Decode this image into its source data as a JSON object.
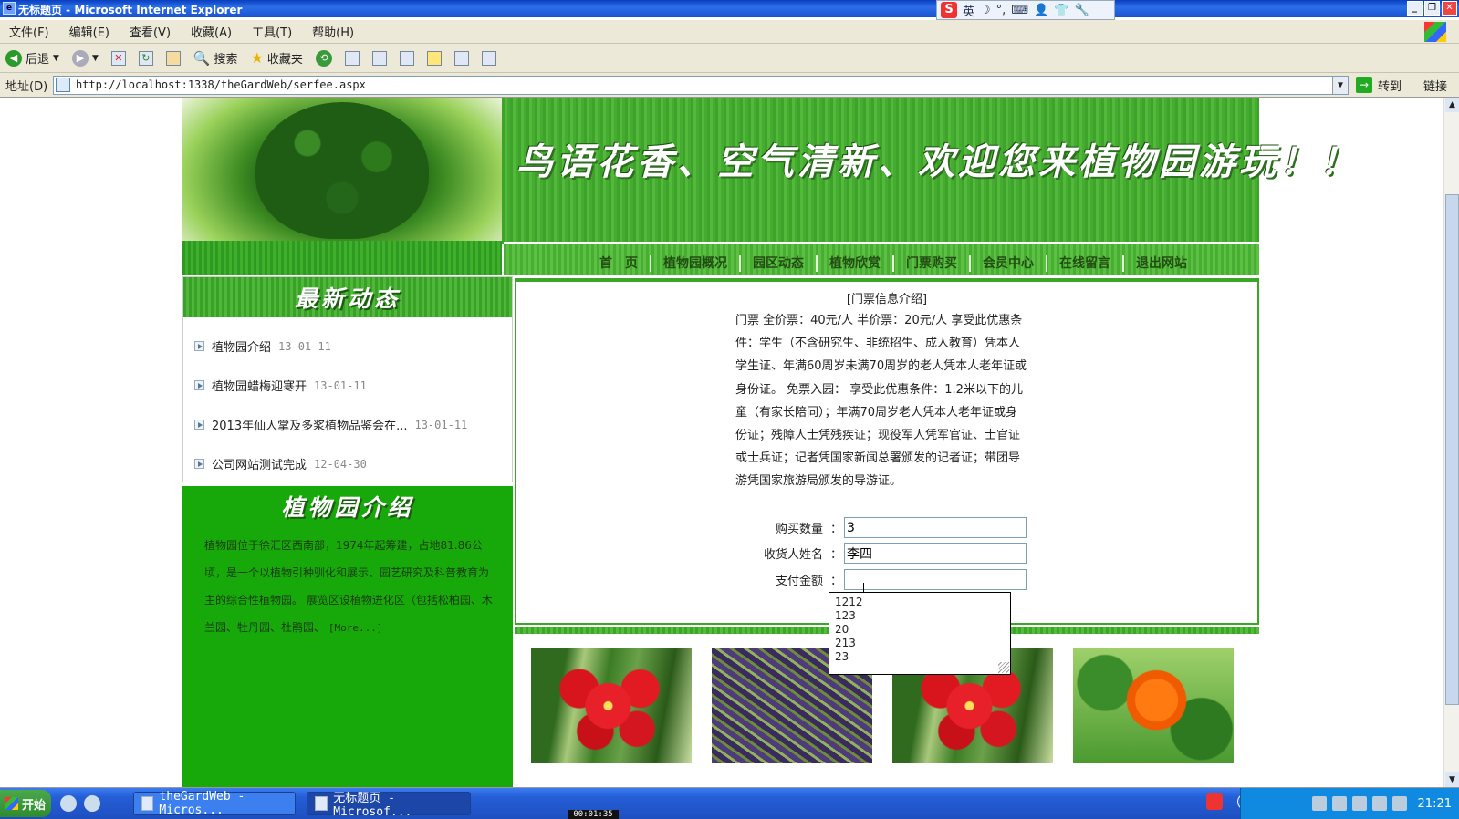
{
  "window": {
    "title": "无标题页 - Microsoft Internet Explorer",
    "controls": [
      "_",
      "❐",
      "✕"
    ]
  },
  "ime": {
    "items": [
      "S",
      "英",
      "☽",
      "°,",
      "⌨",
      "👤",
      "👕",
      "🔧"
    ]
  },
  "menu": [
    "文件(F)",
    "编辑(E)",
    "查看(V)",
    "收藏(A)",
    "工具(T)",
    "帮助(H)"
  ],
  "toolbar": {
    "back": "后退",
    "search": "搜索",
    "favorites": "收藏夹"
  },
  "address": {
    "label": "地址(D)",
    "url": "http://localhost:1338/theGardWeb/serfee.aspx",
    "go": "转到",
    "links": "链接"
  },
  "site": {
    "banner_title": "鸟语花香、空气清新、欢迎您来植物园游玩！！",
    "nav": [
      "首　页",
      "植物园概况",
      "园区动态",
      "植物欣赏",
      "门票购买",
      "会员中心",
      "在线留言",
      "退出网站"
    ],
    "news": {
      "heading": "最新动态",
      "items": [
        {
          "title": "植物园介绍",
          "date": "13-01-11"
        },
        {
          "title": "植物园蜡梅迎寒开",
          "date": "13-01-11"
        },
        {
          "title": "2013年仙人掌及多浆植物品鉴会在...",
          "date": "13-01-11"
        },
        {
          "title": "公司网站测试完成",
          "date": "12-04-30"
        }
      ]
    },
    "intro": {
      "heading": "植物园介绍",
      "text": "植物园位于徐汇区西南部，1974年起筹建，占地81.86公顷，是一个以植物引种驯化和展示、园艺研究及科普教育为主的综合性植物园。 展览区设植物进化区（包括松柏园、木兰园、牡丹园、杜鹃园、",
      "more": "[More...]"
    },
    "ticket": {
      "title": "[门票信息介绍]",
      "description": "门票 全价票：40元/人 半价票：20元/人 享受此优惠条件：学生（不含研究生、非统招生、成人教育）凭本人学生证、年满60周岁未满70周岁的老人凭本人老年证或身份证。 免票入园： 享受此优惠条件：1.2米以下的儿童（有家长陪同）；年满70周岁老人凭本人老年证或身份证；残障人士凭残疾证；现役军人凭军官证、士官证或士兵证；记者凭国家新闻总署颁发的记者证；带团导游凭国家旅游局颁发的导游证。",
      "fields": [
        {
          "label": "购买数量",
          "value": "3"
        },
        {
          "label": "收货人姓名",
          "value": "李四"
        },
        {
          "label": "支付金额",
          "value": ""
        }
      ],
      "colon": "：",
      "autocomplete": [
        "1212",
        "123",
        "20",
        "213",
        "23"
      ]
    }
  },
  "taskbar": {
    "start": "开始",
    "tasks": [
      "theGardWeb - Micros...",
      "无标题页 - Microsof..."
    ],
    "clock": "21:21"
  },
  "recorder_timer": "00:01:35"
}
